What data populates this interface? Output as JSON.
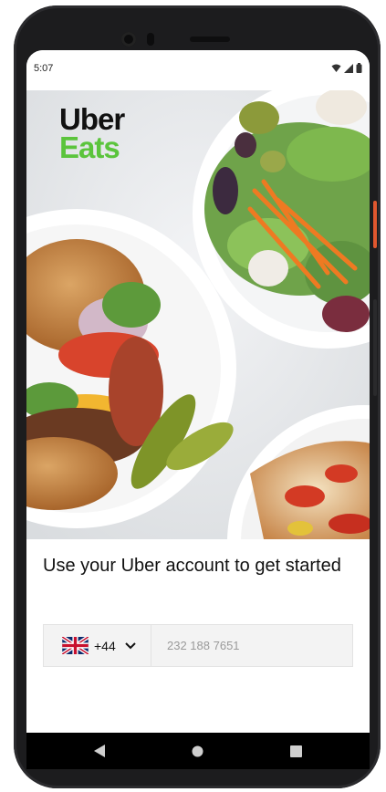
{
  "status_bar": {
    "time": "5:07"
  },
  "brand": {
    "line1": "Uber",
    "line2": "Eats",
    "green": "#5bc43c"
  },
  "onboarding": {
    "headline": "Use your Uber account to get started",
    "country_code": "+44",
    "country_flag": "uk-flag-icon",
    "phone_placeholder": "232 188 7651"
  },
  "nav": {
    "back": "back-icon",
    "home": "home-icon",
    "recents": "recents-icon"
  }
}
